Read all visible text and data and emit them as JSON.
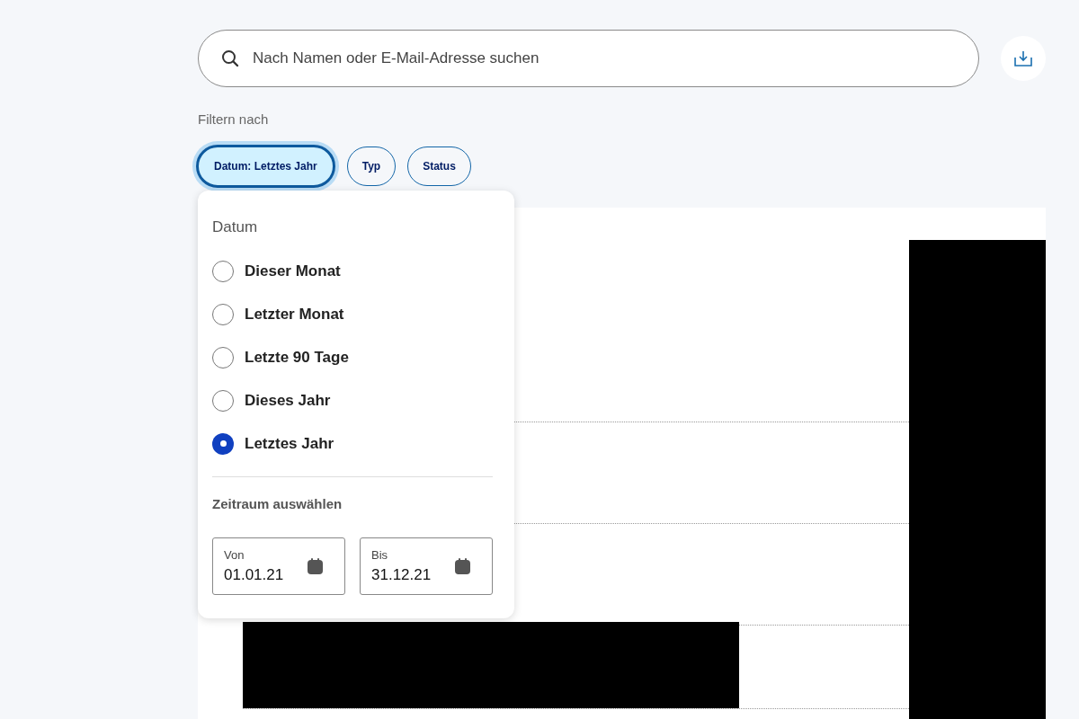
{
  "search": {
    "placeholder": "Nach Namen oder E-Mail-Adresse suchen"
  },
  "filter": {
    "label": "Filtern nach",
    "chips": [
      {
        "label": "Datum: Letztes Jahr",
        "selected": true
      },
      {
        "label": "Typ",
        "selected": false
      },
      {
        "label": "Status",
        "selected": false
      }
    ]
  },
  "date_menu": {
    "heading": "Datum",
    "options": [
      {
        "label": "Dieser Monat",
        "selected": false
      },
      {
        "label": "Letzter Monat",
        "selected": false
      },
      {
        "label": "Letzte 90 Tage",
        "selected": false
      },
      {
        "label": "Dieses Jahr",
        "selected": false
      },
      {
        "label": "Letztes Jahr",
        "selected": true
      }
    ],
    "range_label": "Zeitraum auswählen",
    "fields": [
      {
        "label": "Von",
        "value": "01.01.21"
      },
      {
        "label": "Bis",
        "value": "31.12.21"
      }
    ]
  }
}
